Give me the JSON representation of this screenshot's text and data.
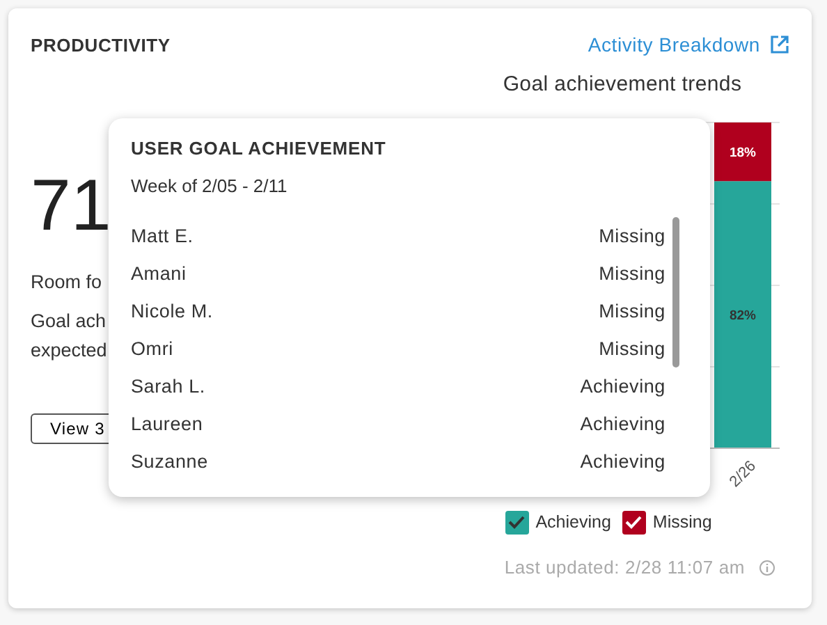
{
  "header": {
    "title": "PRODUCTIVITY",
    "link": "Activity Breakdown"
  },
  "summary": {
    "value": "71",
    "lines": [
      "Room fo",
      "Goal ach",
      "expected"
    ],
    "button": "View 3"
  },
  "chart": {
    "title": "Goal achievement trends",
    "chart_data": {
      "type": "bar",
      "stacked": true,
      "categories": [
        "2/26"
      ],
      "series": [
        {
          "name": "Achieving",
          "color": "#26a69a",
          "values": [
            82
          ],
          "value_labels": [
            "82%"
          ]
        },
        {
          "name": "Missing",
          "color": "#b0001e",
          "values": [
            18
          ],
          "value_labels": [
            "18%"
          ]
        }
      ]
    }
  },
  "legend": [
    {
      "checked": true
    },
    {
      "checked": true
    }
  ],
  "footer": "Last updated: 2/28 11:07 am",
  "popup": {
    "title": "USER GOAL ACHIEVEMENT",
    "subtitle": "Week of 2/05 - 2/11",
    "rows": [
      {
        "name": "Matt E.",
        "status": "Missing"
      },
      {
        "name": "Amani",
        "status": "Missing"
      },
      {
        "name": "Nicole M.",
        "status": "Missing"
      },
      {
        "name": "Omri",
        "status": "Missing"
      },
      {
        "name": "Sarah L.",
        "status": "Achieving"
      },
      {
        "name": "Laureen",
        "status": "Achieving"
      },
      {
        "name": "Suzanne",
        "status": "Achieving"
      }
    ]
  }
}
